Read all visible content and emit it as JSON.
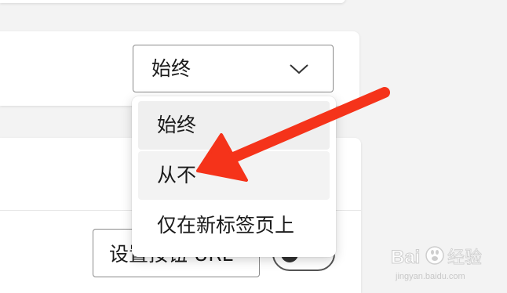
{
  "settings": {
    "select": {
      "current_value": "始终",
      "options": [
        {
          "label": "始终"
        },
        {
          "label": "从不"
        },
        {
          "label": "仅在新标签页上"
        }
      ]
    },
    "url_button_label": "设置按钮 URL"
  },
  "icons": {
    "chevron": "chevron-down-icon",
    "arrow": "red-arrow-annotation"
  },
  "colors": {
    "arrow": "#f5331a",
    "hover": "#efefef",
    "background": "#f3f3f3"
  },
  "watermark": {
    "text": "Bai度经验",
    "url": "jingyan.baidu.com"
  }
}
